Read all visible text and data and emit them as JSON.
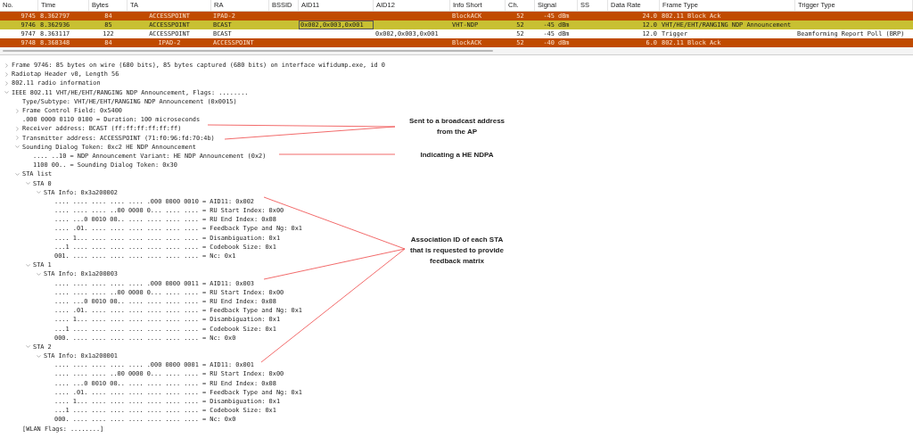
{
  "packet_list": {
    "columns": [
      "No.",
      "Time",
      "Bytes",
      "TA",
      "RA",
      "BSSID",
      "AID11",
      "AID12",
      "Info Short",
      "Ch.",
      "Signal",
      "SS",
      "Data Rate",
      "Frame Type",
      "Trigger Type"
    ],
    "rows": [
      {
        "color": "#c04b00",
        "selected": false,
        "cells": {
          "no": "9745",
          "time": "8.362797",
          "bytes": "84",
          "ta": "ACCESSPOINT",
          "ra": "IPAD-2",
          "info_short": "BlockACK",
          "ch": "52",
          "signal": "-45 dBm",
          "data_rate": "24.0",
          "frame_type": "802.11 Block Ack"
        }
      },
      {
        "color": "#c8c032",
        "selected": true,
        "cells": {
          "no": "9746",
          "time": "8.362936",
          "bytes": "85",
          "ta": "ACCESSPOINT",
          "ra": "BCAST",
          "aid11": "0x002,0x003,0x001",
          "info_short": "VHT-NDP",
          "ch": "52",
          "signal": "-45 dBm",
          "data_rate": "12.0",
          "frame_type": "VHT/HE/EHT/RANGING NDP Announcement"
        }
      },
      {
        "color": "#ffffff",
        "selected": false,
        "cells": {
          "no": "9747",
          "time": "8.363117",
          "bytes": "122",
          "ta": "ACCESSPOINT",
          "ra": "BCAST",
          "aid12": "0x002,0x003,0x001",
          "ch": "52",
          "signal": "-45 dBm",
          "data_rate": "12.0",
          "frame_type": "Trigger",
          "trigger_type": "Beamforming Report Poll (BRP)"
        }
      },
      {
        "color": "#c04b00",
        "selected": false,
        "cells": {
          "no": "9748",
          "time": "8.368348",
          "bytes": "84",
          "ta": "IPAD-2",
          "ra": "ACCESSPOINT",
          "info_short": "BlockACK",
          "ch": "52",
          "signal": "-40 dBm",
          "data_rate": "6.0",
          "frame_type": "802.11 Block Ack"
        }
      }
    ]
  },
  "details": [
    {
      "text": "Frame 9746: 85 bytes on wire (680 bits), 85 bytes captured (680 bits) on interface wifidump.exe, id 0",
      "expanded": false
    },
    {
      "text": "Radiotap Header v0, Length 56",
      "expanded": false
    },
    {
      "text": "802.11 radio information",
      "expanded": false
    },
    {
      "text": "IEEE 802.11 VHT/HE/EHT/RANGING NDP Announcement, Flags: ........",
      "expanded": true,
      "children": [
        {
          "text": "Type/Subtype: VHT/HE/EHT/RANGING NDP Announcement (0x0015)"
        },
        {
          "text": "Frame Control Field: 0x5400",
          "expanded": false
        },
        {
          "text": ".000 0000 0110 0100 = Duration: 100 microseconds"
        },
        {
          "text": "Receiver address: BCAST (ff:ff:ff:ff:ff:ff)",
          "expanded": false
        },
        {
          "text": "Transmitter address: ACCESSPOINT (71:f0:96:fd:70:4b)",
          "expanded": false
        },
        {
          "text": "Sounding Dialog Token: 0xc2 HE NDP Announcement",
          "expanded": true,
          "children": [
            {
              "text": ".... ..10 = NDP Announcement Variant: HE NDP Announcement (0x2)"
            },
            {
              "text": "1100 00.. = Sounding Dialog Token: 0x30"
            }
          ]
        },
        {
          "text": "STA list",
          "expanded": true,
          "children": [
            {
              "text": "STA 0",
              "expanded": true,
              "children": [
                {
                  "text": "STA Info: 0x3a200002",
                  "expanded": true,
                  "children": [
                    {
                      "text": ".... .... .... .... .... .000 0000 0010 = AID11: 0x002"
                    },
                    {
                      "text": ".... .... .... ..00 0000 0... .... .... = RU Start Index: 0x00"
                    },
                    {
                      "text": ".... ...0 0010 00.. .... .... .... .... = RU End Index: 0x08"
                    },
                    {
                      "text": ".... .01. .... .... .... .... .... .... = Feedback Type and Ng: 0x1"
                    },
                    {
                      "text": ".... 1... .... .... .... .... .... .... = Disambiguation: 0x1"
                    },
                    {
                      "text": "...1 .... .... .... .... .... .... .... = Codebook Size: 0x1"
                    },
                    {
                      "text": "001. .... .... .... .... .... .... .... = Nc: 0x1"
                    }
                  ]
                }
              ]
            },
            {
              "text": "STA 1",
              "expanded": true,
              "children": [
                {
                  "text": "STA Info: 0x1a200003",
                  "expanded": true,
                  "children": [
                    {
                      "text": ".... .... .... .... .... .000 0000 0011 = AID11: 0x003"
                    },
                    {
                      "text": ".... .... .... ..00 0000 0... .... .... = RU Start Index: 0x00"
                    },
                    {
                      "text": ".... ...0 0010 00.. .... .... .... .... = RU End Index: 0x08"
                    },
                    {
                      "text": ".... .01. .... .... .... .... .... .... = Feedback Type and Ng: 0x1"
                    },
                    {
                      "text": ".... 1... .... .... .... .... .... .... = Disambiguation: 0x1"
                    },
                    {
                      "text": "...1 .... .... .... .... .... .... .... = Codebook Size: 0x1"
                    },
                    {
                      "text": "000. .... .... .... .... .... .... .... = Nc: 0x0"
                    }
                  ]
                }
              ]
            },
            {
              "text": "STA 2",
              "expanded": true,
              "children": [
                {
                  "text": "STA Info: 0x1a200001",
                  "expanded": true,
                  "children": [
                    {
                      "text": ".... .... .... .... .... .000 0000 0001 = AID11: 0x001"
                    },
                    {
                      "text": ".... .... .... ..00 0000 0... .... .... = RU Start Index: 0x00"
                    },
                    {
                      "text": ".... ...0 0010 00.. .... .... .... .... = RU End Index: 0x08"
                    },
                    {
                      "text": ".... .01. .... .... .... .... .... .... = Feedback Type and Ng: 0x1"
                    },
                    {
                      "text": ".... 1... .... .... .... .... .... .... = Disambiguation: 0x1"
                    },
                    {
                      "text": "...1 .... .... .... .... .... .... .... = Codebook Size: 0x1"
                    },
                    {
                      "text": "000. .... .... .... .... .... .... .... = Nc: 0x0"
                    }
                  ]
                }
              ]
            }
          ]
        },
        {
          "text": "[WLAN Flags: ........]"
        }
      ]
    }
  ],
  "annotations": [
    {
      "text": "Sent to a broadcast address\nfrom the AP"
    },
    {
      "text": "Indicating a HE NDPA"
    },
    {
      "text": "Association ID of each STA\nthat is requested to provide\nfeedback matrix"
    }
  ]
}
